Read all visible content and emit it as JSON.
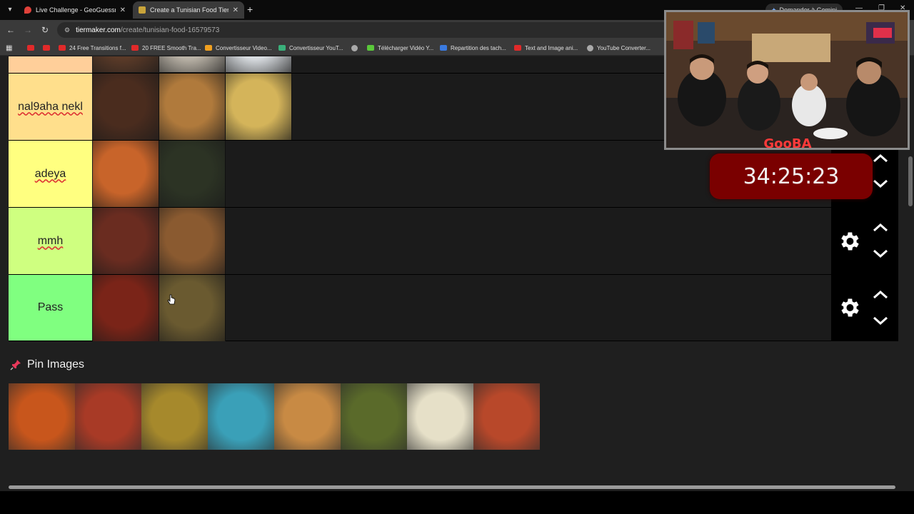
{
  "browser": {
    "tabs": [
      {
        "title": "Live Challenge - GeoGuessr",
        "active": false
      },
      {
        "title": "Create a Tunisian Food Tier List",
        "active": true
      }
    ],
    "gemini_label": "Demander à Gemini",
    "url_host": "tiermaker.com",
    "url_path": "/create/tunisian-food-16579573",
    "bookmarks": [
      {
        "label": "",
        "icon": "youtube-icon"
      },
      {
        "label": "",
        "icon": "youtube-icon"
      },
      {
        "label": "24 Free Transitions f...",
        "icon": "youtube-icon"
      },
      {
        "label": "20 FREE Smooth Tra...",
        "icon": "youtube-icon"
      },
      {
        "label": "Convertisseur Video...",
        "icon": "z-icon"
      },
      {
        "label": "Convertisseur YouT...",
        "icon": "leaf-icon"
      },
      {
        "label": "",
        "icon": "globe-icon"
      },
      {
        "label": "Télécharger Vidéo Y...",
        "icon": "download-icon"
      },
      {
        "label": "Repartition des tach...",
        "icon": "docs-icon"
      },
      {
        "label": "Text and Image ani...",
        "icon": "youtube-icon"
      },
      {
        "label": "YouTube Converter...",
        "icon": "globe-icon"
      }
    ]
  },
  "tiers": [
    {
      "label": "",
      "color": "#ffcf9a",
      "items": [
        "#5a3a28",
        "#b9b2a6",
        "#d8dce0"
      ]
    },
    {
      "label": "nal9aha nekl",
      "color": "#ffdf8c",
      "items": [
        "#4a2c1e",
        "#b07a3c",
        "#d4b45a"
      ]
    },
    {
      "label": "adeya",
      "color": "#ffff80",
      "items": [
        "#c8642a",
        "#2c3324"
      ]
    },
    {
      "label": "mmh",
      "color": "#cfff80",
      "items": [
        "#6a2c20",
        "#8a5a30"
      ]
    },
    {
      "label": "Pass",
      "color": "#80ff80",
      "items": [
        "#7a2418",
        "#6a5a30"
      ]
    }
  ],
  "pin": {
    "title": "Pin Images",
    "icon": "pin-icon",
    "images": [
      "#c8561c",
      "#a83a26",
      "#a6892c",
      "#3aa0b8",
      "#c88a44",
      "#5a6a2a",
      "#e6e0c8",
      "#b8482a"
    ]
  },
  "overlay": {
    "timer": "34:25:23",
    "logo_text": "GooBA"
  }
}
